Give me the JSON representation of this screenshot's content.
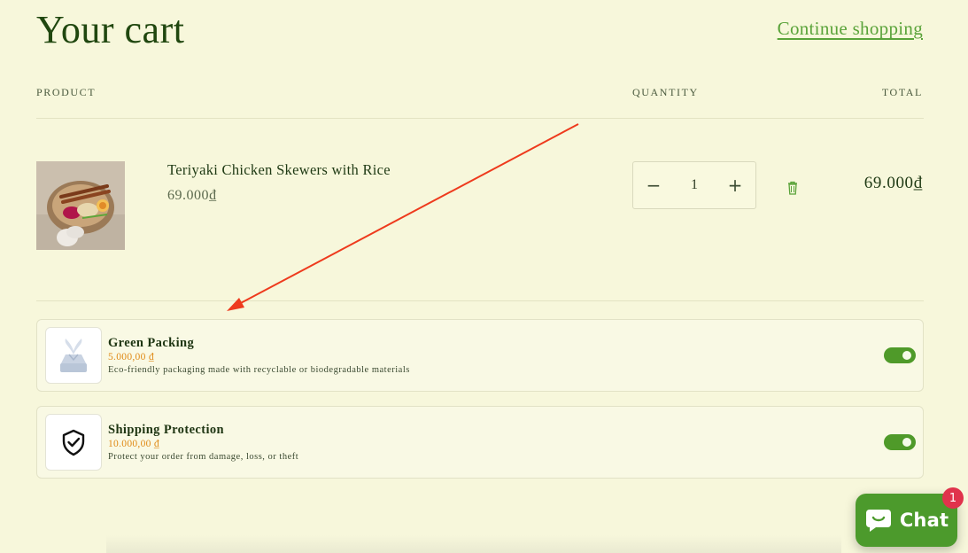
{
  "page": {
    "title": "Your cart",
    "continue_label": "Continue shopping"
  },
  "table": {
    "headers": {
      "product": "PRODUCT",
      "quantity": "QUANTITY",
      "total": "TOTAL"
    }
  },
  "cart_item": {
    "name": "Teriyaki Chicken Skewers with Rice",
    "price": "69.000₫",
    "quantity": "1",
    "decrease_symbol": "−",
    "increase_symbol": "+",
    "line_total": "69.000₫"
  },
  "addons": [
    {
      "title": "Green Packing",
      "price": "5.000,00 ₫",
      "description": "Eco-friendly packaging made with recyclable or biodegradable materials",
      "enabled": true,
      "icon": "gift-box-icon"
    },
    {
      "title": "Shipping Protection",
      "price": "10.000,00 ₫",
      "description": "Protect your order from damage, loss, or theft",
      "enabled": true,
      "icon": "shield-check-icon"
    }
  ],
  "chat": {
    "label": "Chat",
    "badge": "1"
  },
  "colors": {
    "background": "#f7f7db",
    "accent": "#4f9a29",
    "link": "#5aa33a",
    "price_orange": "#e08a16",
    "badge": "#e0334c"
  }
}
